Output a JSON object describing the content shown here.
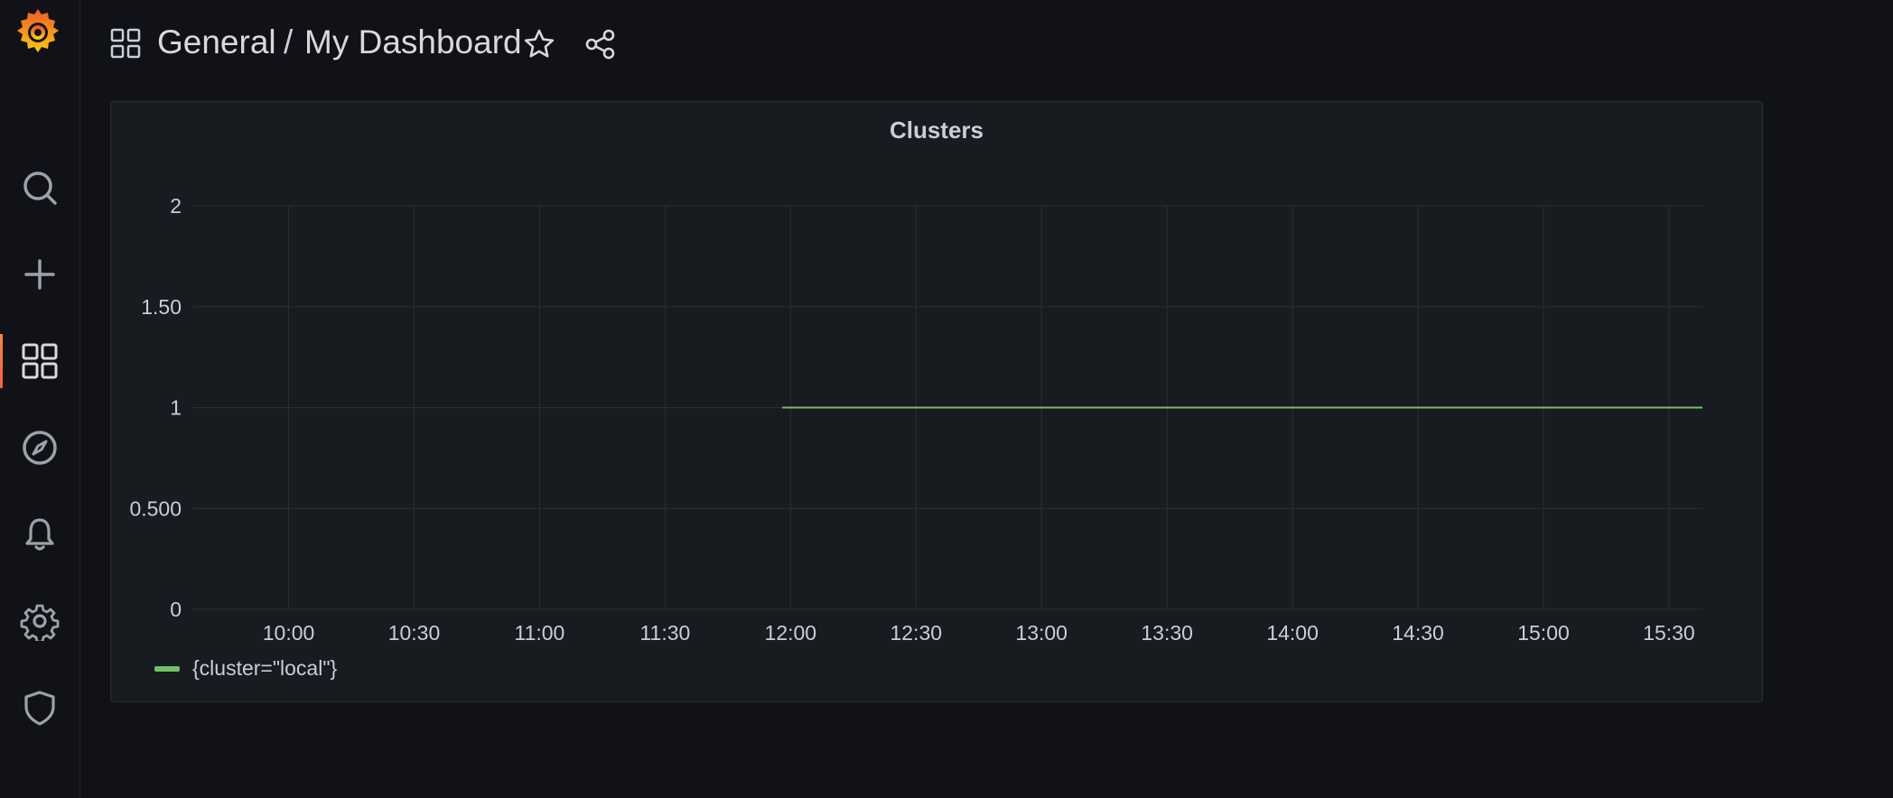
{
  "app": {
    "brand": "grafana-logo",
    "accent": "#f46800"
  },
  "sidebar": {
    "items": [
      {
        "name": "search",
        "icon": "search-icon",
        "active": false
      },
      {
        "name": "create",
        "icon": "plus-icon",
        "active": false
      },
      {
        "name": "dashboards",
        "icon": "dashboards-icon",
        "active": true
      },
      {
        "name": "explore",
        "icon": "compass-icon",
        "active": false
      },
      {
        "name": "alerting",
        "icon": "bell-icon",
        "active": false
      },
      {
        "name": "configuration",
        "icon": "gear-icon",
        "active": false
      },
      {
        "name": "server-admin",
        "icon": "shield-icon",
        "active": false
      }
    ]
  },
  "header": {
    "folder": "General",
    "separator": "/",
    "title": "My Dashboard"
  },
  "panel": {
    "title": "Clusters"
  },
  "chart_data": {
    "type": "line",
    "title": "Clusters",
    "y_ticks": [
      "0",
      "0.500",
      "1",
      "1.50",
      "2"
    ],
    "ylim": [
      0,
      2
    ],
    "x_ticks": [
      "10:00",
      "10:30",
      "11:00",
      "11:30",
      "12:00",
      "12:30",
      "13:00",
      "13:30",
      "14:00",
      "14:30",
      "15:00",
      "15:30"
    ],
    "xlim": [
      "09:37",
      "15:38"
    ],
    "grid": true,
    "legend": "bottom-left",
    "series": [
      {
        "name": "{cluster=\"local\"}",
        "color": "#73bf69",
        "x": [
          "11:58",
          "15:38"
        ],
        "y": [
          1,
          1
        ]
      }
    ]
  }
}
